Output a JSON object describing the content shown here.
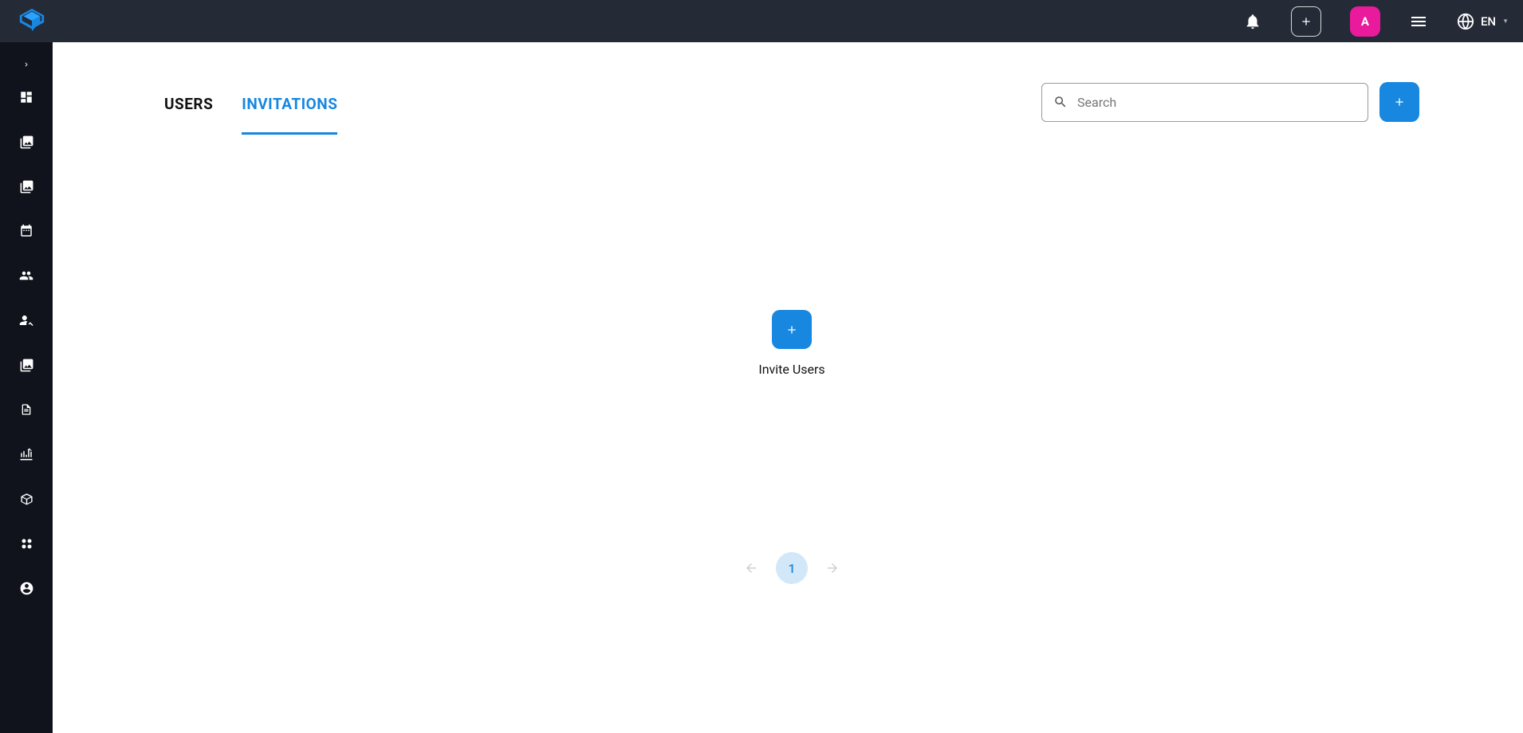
{
  "header": {
    "avatar_letter": "A",
    "language": "EN"
  },
  "tabs": {
    "users": "USERS",
    "invitations": "INVITATIONS",
    "active": "invitations"
  },
  "search": {
    "placeholder": "Search"
  },
  "empty_state": {
    "label": "Invite Users"
  },
  "pagination": {
    "current": "1"
  },
  "colors": {
    "header_bg": "#252a37",
    "sidebar_bg": "#10131c",
    "accent": "#1787e0",
    "avatar_bg": "#e91a9c"
  }
}
